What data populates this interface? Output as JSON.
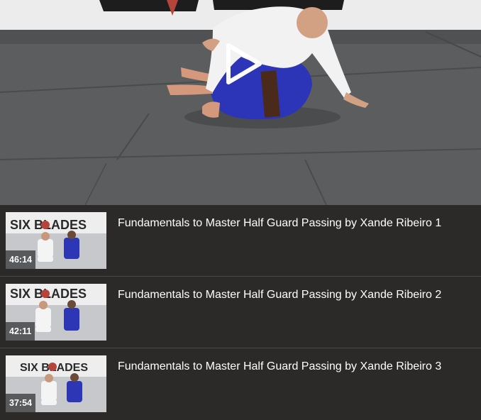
{
  "player": {
    "logo_text": "SIX BLADES",
    "play_icon": "play-icon",
    "accent_color": "#ffffff"
  },
  "playlist": {
    "items": [
      {
        "title": "Fundamentals to Master Half Guard Passing by Xande Ribeiro 1",
        "duration": "46:14",
        "thumb_logo": "SIX BLADES"
      },
      {
        "title": "Fundamentals to Master Half Guard Passing by Xande Ribeiro 2",
        "duration": "42:11",
        "thumb_logo": "SIX BLADES"
      },
      {
        "title": "Fundamentals to Master Half Guard Passing by Xande Ribeiro 3",
        "duration": "37:54",
        "thumb_logo": "SIX BLADES"
      }
    ]
  }
}
